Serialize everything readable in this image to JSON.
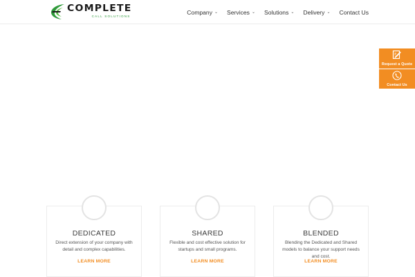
{
  "brand": {
    "name": "COMPLETE",
    "tagline": "CALL SOLUTIONS",
    "colors": {
      "green": "#2e9a3a",
      "orange": "#f28d22",
      "dark": "#1a1a1a"
    }
  },
  "nav": {
    "items": [
      {
        "label": "Company",
        "has_dropdown": true
      },
      {
        "label": "Services",
        "has_dropdown": true
      },
      {
        "label": "Solutions",
        "has_dropdown": true
      },
      {
        "label": "Delivery",
        "has_dropdown": true
      },
      {
        "label": "Contact Us",
        "has_dropdown": false
      }
    ]
  },
  "side_tabs": {
    "quote": {
      "label": "Request a Quote",
      "icon": "edit-document-icon"
    },
    "contact": {
      "label": "Contact Us",
      "icon": "phone-icon"
    }
  },
  "cards": [
    {
      "title": "DEDICATED",
      "desc": "Direct extension of your company with detail and complex capabilities.",
      "link": "LEARN MORE"
    },
    {
      "title": "SHARED",
      "desc": "Flexible and cost effective solution for startups and small programs.",
      "link": "LEARN MORE"
    },
    {
      "title": "BLENDED",
      "desc": "Blending the Dedicated and Shared models to balance your support needs and cost.",
      "link": "LEARN MORE"
    }
  ]
}
